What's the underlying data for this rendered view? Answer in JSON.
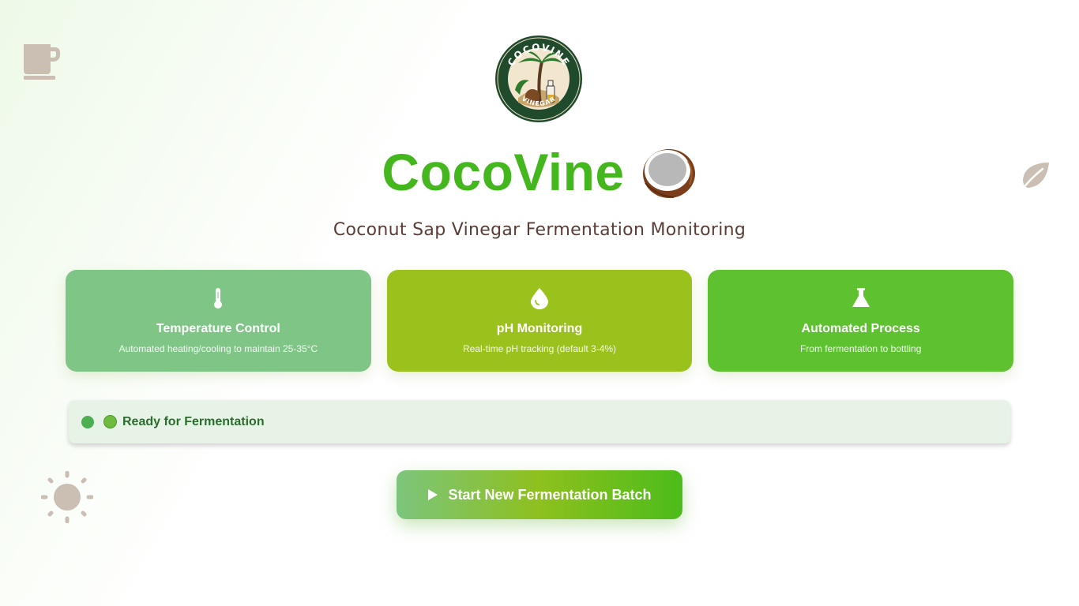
{
  "app": {
    "title": "CocoVine",
    "subtitle": "Coconut Sap Vinegar Fermentation Monitoring",
    "logo_text_top": "COCOVINE",
    "logo_text_bottom": "VINEGAR"
  },
  "features": [
    {
      "icon": "thermometer-icon",
      "title": "Temperature Control",
      "desc": "Automated heating/cooling to maintain 25-35°C"
    },
    {
      "icon": "droplet-icon",
      "title": "pH Monitoring",
      "desc": "Real-time pH tracking (default 3-4%)"
    },
    {
      "icon": "flask-icon",
      "title": "Automated Process",
      "desc": "From fermentation to bottling"
    }
  ],
  "status": {
    "text": "Ready for Fermentation",
    "color": "#4caf50"
  },
  "actions": {
    "start_label": "Start New Fermentation Batch"
  },
  "colors": {
    "brand": "#45b71e",
    "subtitle": "#5a3d36",
    "status_bg": "#e7f3e7"
  }
}
